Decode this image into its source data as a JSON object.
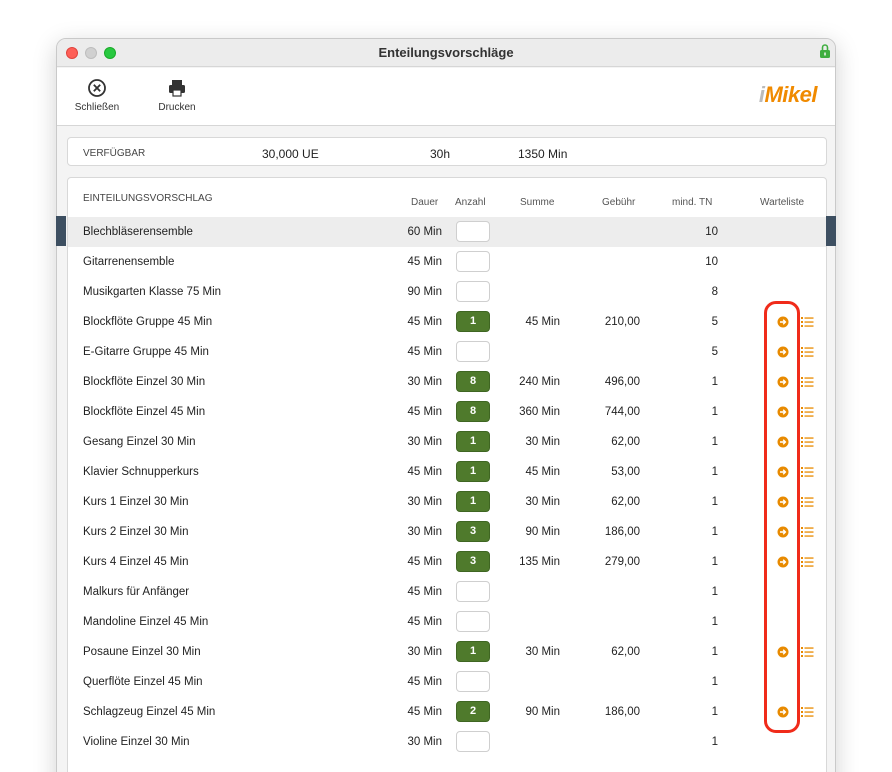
{
  "window": {
    "title": "Enteilungsvorschläge"
  },
  "toolbar": {
    "close_label": "Schließen",
    "print_label": "Drucken"
  },
  "logo": {
    "prefix": "i",
    "text": "Mikel"
  },
  "available": {
    "label": "VERFÜGBAR",
    "ue": "30,000 UE",
    "hours": "30h",
    "minutes": "1350 Min"
  },
  "table": {
    "title": "EINTEILUNGSVORSCHLAG",
    "headers": {
      "dauer": "Dauer",
      "anzahl": "Anzahl",
      "summe": "Summe",
      "gebuehr": "Gebühr",
      "tn": "mind. TN",
      "warteliste": "Warteliste"
    },
    "rows": [
      {
        "name": "Blechbläserensemble",
        "dauer": "60 Min",
        "anzahl": "",
        "summe": "",
        "gebuehr": "",
        "tn": "10",
        "wait": false
      },
      {
        "name": "Gitarrenensemble",
        "dauer": "45 Min",
        "anzahl": "",
        "summe": "",
        "gebuehr": "",
        "tn": "10",
        "wait": false
      },
      {
        "name": "Musikgarten Klasse 75 Min",
        "dauer": "90 Min",
        "anzahl": "",
        "summe": "",
        "gebuehr": "",
        "tn": "8",
        "wait": false
      },
      {
        "name": "Blockflöte Gruppe 45 Min",
        "dauer": "45 Min",
        "anzahl": "1",
        "summe": "45 Min",
        "gebuehr": "210,00",
        "tn": "5",
        "wait": true
      },
      {
        "name": "E-Gitarre Gruppe 45 Min",
        "dauer": "45 Min",
        "anzahl": "",
        "summe": "",
        "gebuehr": "",
        "tn": "5",
        "wait": true
      },
      {
        "name": "Blockflöte Einzel 30 Min",
        "dauer": "30 Min",
        "anzahl": "8",
        "summe": "240 Min",
        "gebuehr": "496,00",
        "tn": "1",
        "wait": true
      },
      {
        "name": "Blockflöte Einzel 45 Min",
        "dauer": "45 Min",
        "anzahl": "8",
        "summe": "360 Min",
        "gebuehr": "744,00",
        "tn": "1",
        "wait": true
      },
      {
        "name": "Gesang Einzel 30 Min",
        "dauer": "30 Min",
        "anzahl": "1",
        "summe": "30 Min",
        "gebuehr": "62,00",
        "tn": "1",
        "wait": true
      },
      {
        "name": "Klavier Schnupperkurs",
        "dauer": "45 Min",
        "anzahl": "1",
        "summe": "45 Min",
        "gebuehr": "53,00",
        "tn": "1",
        "wait": true
      },
      {
        "name": "Kurs 1 Einzel 30 Min",
        "dauer": "30 Min",
        "anzahl": "1",
        "summe": "30 Min",
        "gebuehr": "62,00",
        "tn": "1",
        "wait": true
      },
      {
        "name": "Kurs 2 Einzel 30 Min",
        "dauer": "30 Min",
        "anzahl": "3",
        "summe": "90 Min",
        "gebuehr": "186,00",
        "tn": "1",
        "wait": true
      },
      {
        "name": "Kurs 4 Einzel 45 Min",
        "dauer": "45 Min",
        "anzahl": "3",
        "summe": "135 Min",
        "gebuehr": "279,00",
        "tn": "1",
        "wait": true
      },
      {
        "name": "Malkurs für Anfänger",
        "dauer": "45 Min",
        "anzahl": "",
        "summe": "",
        "gebuehr": "",
        "tn": "1",
        "wait": false
      },
      {
        "name": "Mandoline Einzel 45 Min",
        "dauer": "45 Min",
        "anzahl": "",
        "summe": "",
        "gebuehr": "",
        "tn": "1",
        "wait": false
      },
      {
        "name": "Posaune Einzel 30 Min",
        "dauer": "30 Min",
        "anzahl": "1",
        "summe": "30 Min",
        "gebuehr": "62,00",
        "tn": "1",
        "wait": true
      },
      {
        "name": "Querflöte Einzel 45 Min",
        "dauer": "45 Min",
        "anzahl": "",
        "summe": "",
        "gebuehr": "",
        "tn": "1",
        "wait": false
      },
      {
        "name": "Schlagzeug Einzel 45 Min",
        "dauer": "45 Min",
        "anzahl": "2",
        "summe": "90 Min",
        "gebuehr": "186,00",
        "tn": "1",
        "wait": true
      },
      {
        "name": "Violine Einzel 30 Min",
        "dauer": "30 Min",
        "anzahl": "",
        "summe": "",
        "gebuehr": "",
        "tn": "1",
        "wait": false
      }
    ]
  },
  "colors": {
    "accent_green": "#4f7a2c",
    "warteliste_orange": "#e88a00",
    "highlight_red": "#f02b1a",
    "selection_bar": "#3d4f61"
  },
  "icons": {
    "close": "close-circle-icon",
    "print": "printer-icon",
    "arrow": "arrow-right-circle-icon",
    "list": "list-icon",
    "lock": "lock-icon"
  }
}
